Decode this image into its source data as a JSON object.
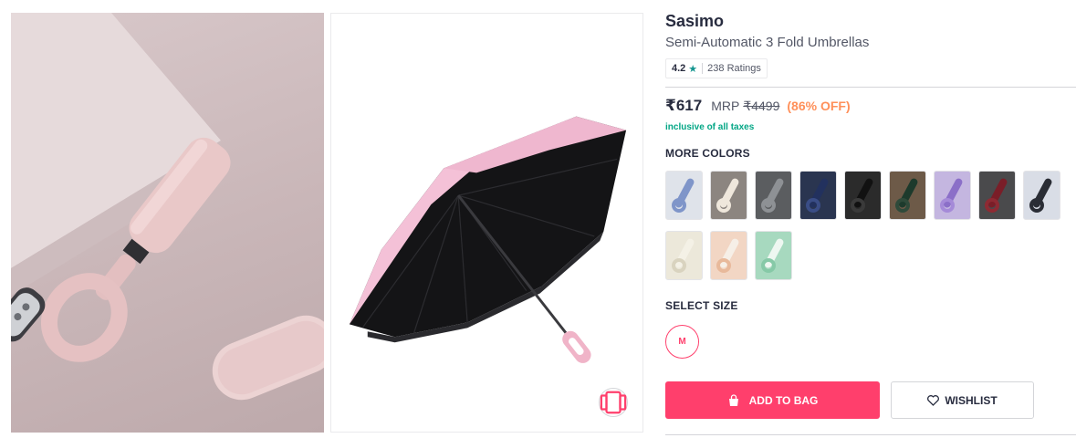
{
  "product": {
    "brand": "Sasimo",
    "name": "Semi-Automatic 3 Fold Umbrellas",
    "rating": "4.2",
    "star": "★",
    "ratings_count": "238 Ratings",
    "price": "₹617",
    "mrp_label": "MRP",
    "mrp_value": "₹4499",
    "discount": "(86% OFF)",
    "tax_note": "inclusive of all taxes"
  },
  "colors": {
    "title": "MORE COLORS",
    "swatches": [
      {
        "bg": "#dfe3ea",
        "stick": "#7f95c9",
        "ring": "#7f95c9"
      },
      {
        "bg": "#8c8580",
        "stick": "#efe7dc",
        "ring": "#efe7dc"
      },
      {
        "bg": "#5b5d60",
        "stick": "#8e9195",
        "ring": "#8e9195"
      },
      {
        "bg": "#2a3550",
        "stick": "#22315e",
        "ring": "#3a4d86"
      },
      {
        "bg": "#2b2b2b",
        "stick": "#111111",
        "ring": "#3a3a3a"
      },
      {
        "bg": "#6d5a48",
        "stick": "#1d3a2c",
        "ring": "#2f4a3a"
      },
      {
        "bg": "#c4b6e0",
        "stick": "#8b6fc8",
        "ring": "#a58ad8"
      },
      {
        "bg": "#4a4a4c",
        "stick": "#7a1e28",
        "ring": "#8e2a33"
      },
      {
        "bg": "#d9dde6",
        "stick": "#2a2d35",
        "ring": "#2a2d35"
      },
      {
        "bg": "#ece8da",
        "stick": "#f4f1e6",
        "ring": "#d9d3bf"
      },
      {
        "bg": "#f2d6c4",
        "stick": "#f6efe7",
        "ring": "#e8b99b"
      },
      {
        "bg": "#a7d9bf",
        "stick": "#eef7f1",
        "ring": "#86c9a7"
      }
    ]
  },
  "size": {
    "title": "SELECT SIZE",
    "selected": "M"
  },
  "actions": {
    "add_to_bag": "ADD TO BAG",
    "wishlist": "WISHLIST"
  },
  "theme": {
    "accent": "#ff3f6c",
    "discount": "#ff905a",
    "tax": "#03a685",
    "star": "#14958f"
  },
  "icons": {
    "bag": "bag-icon",
    "heart": "heart-icon",
    "star": "star-icon",
    "similar": "similar-products-icon"
  }
}
